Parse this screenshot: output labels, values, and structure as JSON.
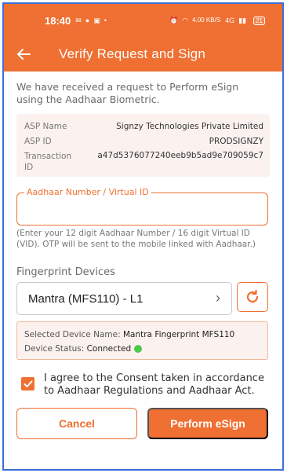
{
  "status_bar": {
    "time": "18:40",
    "network": "4.00 KB/S",
    "signal": "4G",
    "battery": "21"
  },
  "app_bar": {
    "title": "Verify Request and Sign"
  },
  "intro_text": "We have received a request to Perform eSign using the Aadhaar Biometric.",
  "asp": {
    "rows": [
      {
        "key": "ASP Name",
        "value": "Signzy Technologies Private Limited"
      },
      {
        "key": "ASP ID",
        "value": "PRODSIGNZY"
      },
      {
        "key": "Transaction ID",
        "value": "a47d5376077240eeb9b5ad9e709059c7"
      }
    ]
  },
  "aadhaar": {
    "label": "Aadhaar Number / Virtual ID",
    "value": "",
    "hint": "(Enter your 12 digit Aadhaar Number / 16 digit Virtual ID (VID). OTP will be sent to the mobile linked with Aadhaar.)"
  },
  "fingerprint": {
    "heading": "Fingerprint Devices",
    "selected": "Mantra (MFS110) - L1"
  },
  "device_info": {
    "name_label": "Selected Device Name:",
    "name_value": "Mantra Fingerprint MFS110",
    "status_label": "Device Status:",
    "status_value": "Connected",
    "status_color": "#4cc94a"
  },
  "consent": {
    "checked": true,
    "text": "I agree to the Consent taken in accordance to Aadhaar Regulations and Aadhaar Act."
  },
  "buttons": {
    "cancel": "Cancel",
    "perform": "Perform eSign"
  },
  "colors": {
    "accent": "#ef7032",
    "frame_border": "#3a6fd8"
  }
}
